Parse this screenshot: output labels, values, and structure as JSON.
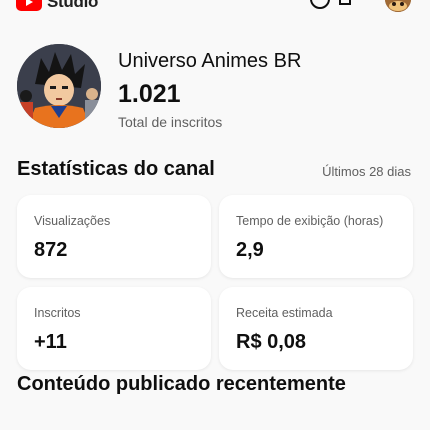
{
  "app": {
    "logo_text": "Studio"
  },
  "channel": {
    "name": "Universo Animes BR",
    "subscriber_count": "1.021",
    "subscriber_label": "Total de inscritos"
  },
  "stats": {
    "title": "Estatísticas do canal",
    "period": "Últimos 28 dias",
    "cards": [
      {
        "label": "Visualizações",
        "value": "872"
      },
      {
        "label": "Tempo de exibição (horas)",
        "value": "2,9"
      },
      {
        "label": "Inscritos",
        "value": "+11"
      },
      {
        "label": "Receita estimada",
        "value": "R$ 0,08"
      }
    ]
  },
  "recent": {
    "title": "Conteúdo publicado recentemente"
  },
  "colors": {
    "brand": "#ff0000",
    "background": "#f9f9f9",
    "card": "#ffffff",
    "secondary_text": "#606060"
  }
}
